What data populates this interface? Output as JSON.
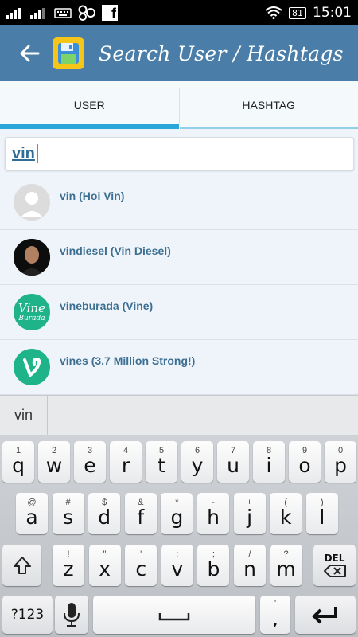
{
  "status_bar": {
    "time": "15:01",
    "battery": "81"
  },
  "app_bar": {
    "title": "Search User / Hashtags"
  },
  "tabs": [
    {
      "label": "USER",
      "active": true
    },
    {
      "label": "HASHTAG",
      "active": false
    }
  ],
  "search": {
    "value": "vin"
  },
  "results": [
    {
      "label": "vin (Hoi Vin)",
      "avatar": "default-avatar-icon"
    },
    {
      "label": "vindiesel (Vin Diesel)",
      "avatar": "profile-photo"
    },
    {
      "label": "vineburada (Vine)",
      "avatar": "vine-burada-logo",
      "logo_text": "Vine",
      "logo_sub": "Burada"
    },
    {
      "label": "vines (3.7 Million Strong!)",
      "avatar": "vine-logo"
    }
  ],
  "suggestion": "vin",
  "keyboard": {
    "row1": [
      {
        "main": "q",
        "sup": "1"
      },
      {
        "main": "w",
        "sup": "2"
      },
      {
        "main": "e",
        "sup": "3"
      },
      {
        "main": "r",
        "sup": "4"
      },
      {
        "main": "t",
        "sup": "5"
      },
      {
        "main": "y",
        "sup": "6"
      },
      {
        "main": "u",
        "sup": "7"
      },
      {
        "main": "i",
        "sup": "8"
      },
      {
        "main": "o",
        "sup": "9"
      },
      {
        "main": "p",
        "sup": "0"
      }
    ],
    "row2": [
      {
        "main": "a",
        "sup": "@"
      },
      {
        "main": "s",
        "sup": "#"
      },
      {
        "main": "d",
        "sup": "$"
      },
      {
        "main": "f",
        "sup": "&"
      },
      {
        "main": "g",
        "sup": "*"
      },
      {
        "main": "h",
        "sup": "-"
      },
      {
        "main": "j",
        "sup": "+"
      },
      {
        "main": "k",
        "sup": "("
      },
      {
        "main": "l",
        "sup": ")"
      }
    ],
    "row3": [
      {
        "main": "z",
        "sup": "!"
      },
      {
        "main": "x",
        "sup": "\""
      },
      {
        "main": "c",
        "sup": "'"
      },
      {
        "main": "v",
        "sup": ":"
      },
      {
        "main": "b",
        "sup": ";"
      },
      {
        "main": "n",
        "sup": "/"
      },
      {
        "main": "m",
        "sup": "?"
      }
    ],
    "del_label": "DEL",
    "symbols_label": "?123",
    "comma_sup": "'",
    "comma_label": ","
  },
  "colors": {
    "app_bar": "#4a7ea9",
    "accent": "#2aa7d9",
    "result_text": "#3d6f93",
    "vine_green": "#1fb38a"
  }
}
